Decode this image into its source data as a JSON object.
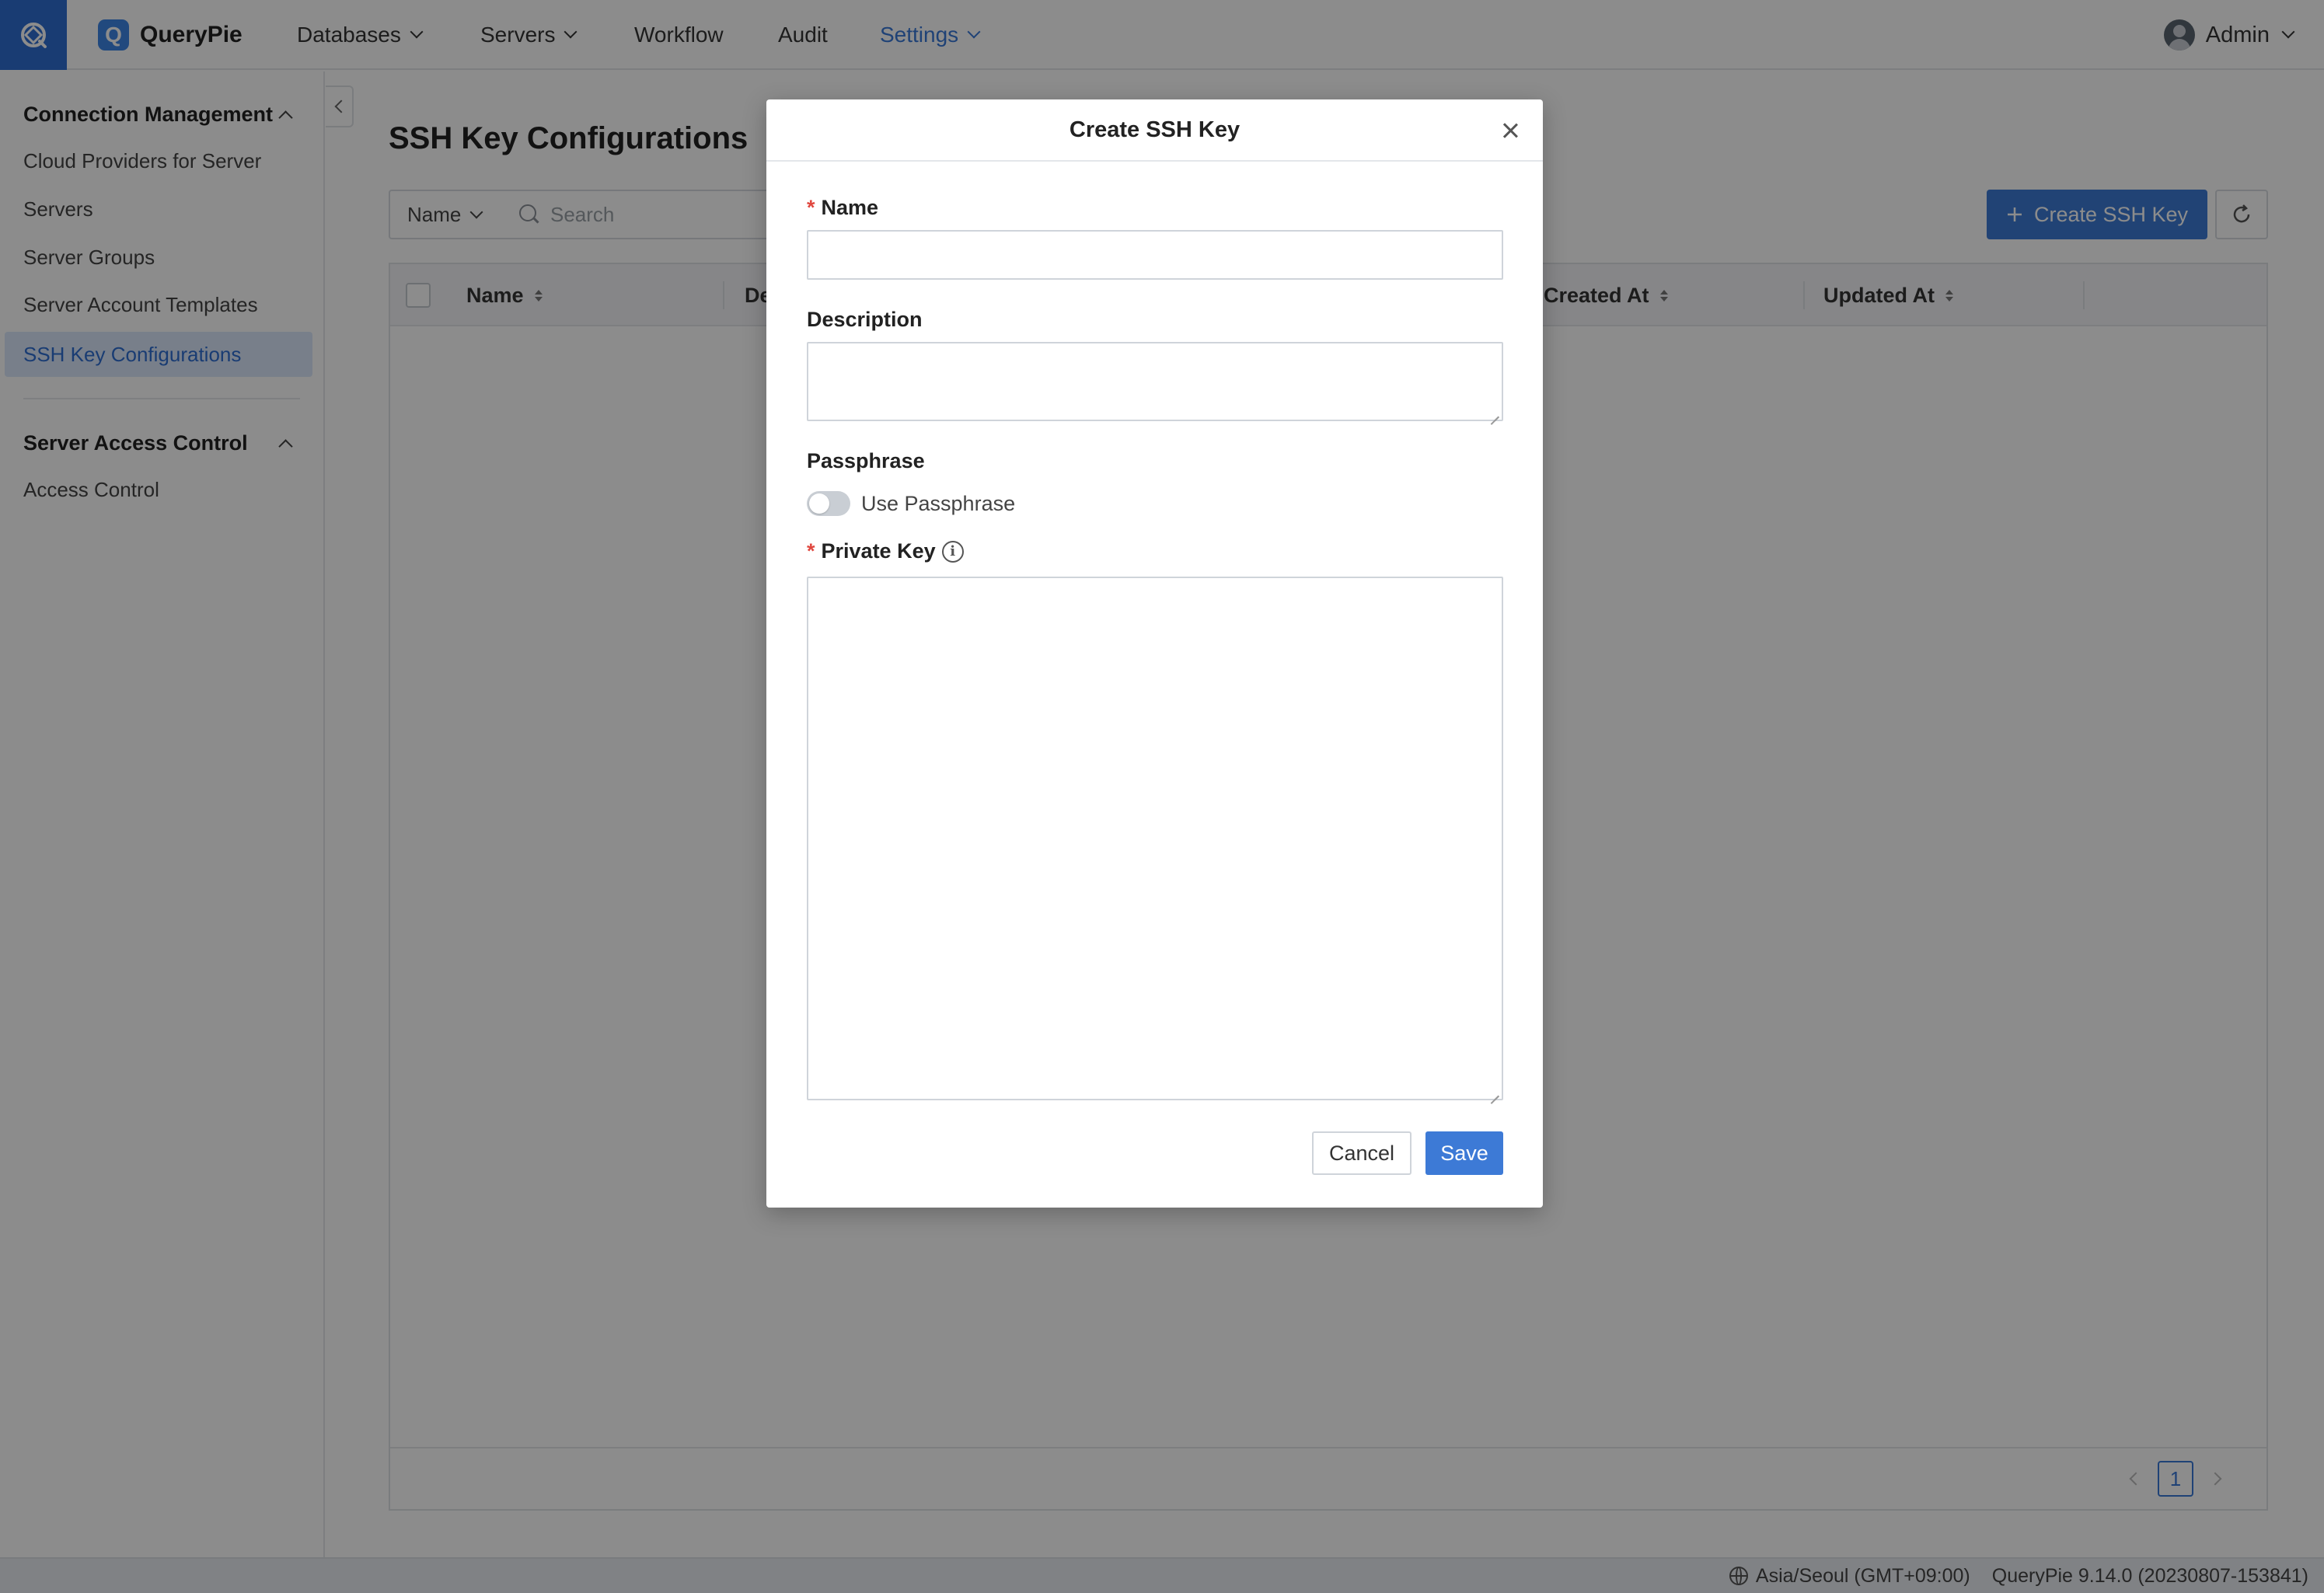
{
  "app": {
    "name": "QueryPie"
  },
  "nav": {
    "items": [
      {
        "label": "Databases",
        "dropdown": true
      },
      {
        "label": "Servers",
        "dropdown": true
      },
      {
        "label": "Workflow",
        "dropdown": false
      },
      {
        "label": "Audit",
        "dropdown": false
      },
      {
        "label": "Settings",
        "dropdown": true,
        "active": true
      }
    ],
    "user": "Admin"
  },
  "sidebar": {
    "groups": [
      {
        "label": "Connection Management",
        "items": [
          {
            "label": "Cloud Providers for Server"
          },
          {
            "label": "Servers"
          },
          {
            "label": "Server Groups"
          },
          {
            "label": "Server Account Templates"
          },
          {
            "label": "SSH Key Configurations",
            "active": true
          }
        ]
      },
      {
        "label": "Server Access Control",
        "items": [
          {
            "label": "Access Control"
          }
        ]
      }
    ]
  },
  "main": {
    "title": "SSH Key Configurations",
    "filter": {
      "field": "Name",
      "search_placeholder": "Search"
    },
    "create_button": "Create SSH Key",
    "table": {
      "columns": [
        "Name",
        "De",
        "Created At",
        "Updated At"
      ],
      "rows": []
    },
    "pagination": {
      "current_page": "1"
    }
  },
  "modal": {
    "title": "Create SSH Key",
    "fields": {
      "name": {
        "label": "Name",
        "required": true,
        "value": ""
      },
      "description": {
        "label": "Description",
        "value": ""
      },
      "passphrase": {
        "label": "Passphrase",
        "toggle_label": "Use Passphrase",
        "enabled": false
      },
      "private_key": {
        "label": "Private Key",
        "required": true,
        "value": ""
      }
    },
    "buttons": {
      "cancel": "Cancel",
      "save": "Save"
    }
  },
  "status_bar": {
    "timezone": "Asia/Seoul (GMT+09:00)",
    "version": "QueryPie 9.14.0 (20230807-153841)"
  },
  "colors": {
    "accent": "#3d7ad6",
    "brand": "#2f6ed1",
    "required": "#e0473f",
    "overlay": "rgba(0,0,0,0.45)"
  },
  "icons": [
    "querypie-logo-icon",
    "chevron-down-icon",
    "avatar-icon",
    "chevron-up-icon",
    "chevron-left-icon",
    "search-icon",
    "plus-icon",
    "refresh-icon",
    "sort-icon",
    "close-icon",
    "info-icon",
    "globe-icon"
  ]
}
